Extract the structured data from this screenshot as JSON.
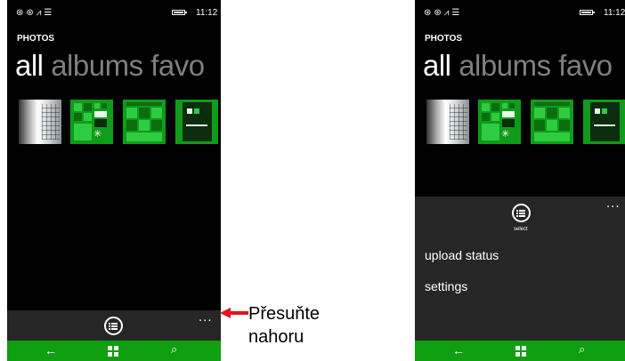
{
  "status_bar": {
    "time": "11:12",
    "icons": [
      "notification-icon",
      "notification-icon",
      "signal-icon",
      "message-icon",
      "battery-icon"
    ]
  },
  "app": {
    "title": "PHOTOS"
  },
  "pivot": {
    "active": "all",
    "inactive": "albums favo"
  },
  "app_bar_left": {
    "more": "...",
    "action_icon": "select-list-icon"
  },
  "app_bar_right": {
    "more": "...",
    "action_icon": "select-list-icon",
    "action_label": "select",
    "menu": [
      "upload status",
      "settings"
    ]
  },
  "nav_bar": {
    "back_icon": "back-arrow-icon",
    "windows_icon": "windows-logo-icon",
    "search_icon": "search-icon",
    "color": "#0f9f10"
  },
  "callout": {
    "line1": "Přesuňte",
    "line2": "nahoru",
    "arrow_color": "#e3141c"
  },
  "colors": {
    "accent": "#0f9f10",
    "app_bar_bg": "#262626",
    "screen_bg": "#000000"
  }
}
